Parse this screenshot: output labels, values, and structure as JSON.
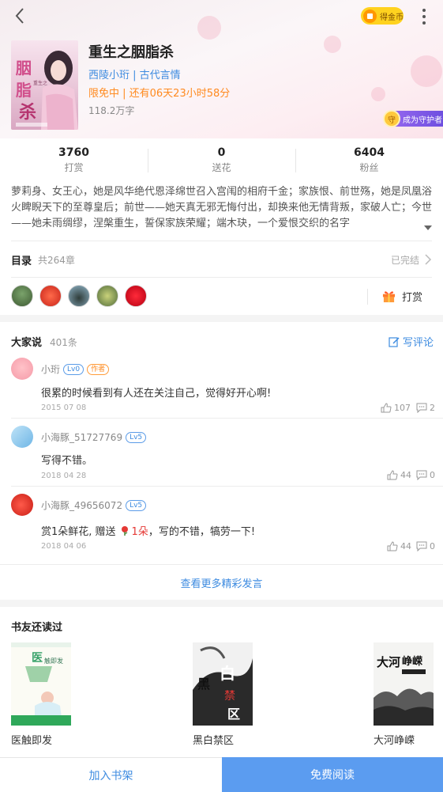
{
  "colors": {
    "accent": "#3d8be0",
    "primary_button": "#5b9cf0",
    "free_orange": "#ff8a1f",
    "coin_yellow": "#ffd21f",
    "guard_purple": "#8a5cf0"
  },
  "header": {
    "back_icon": "chevron-left-icon",
    "coin_label": "得金币",
    "more_icon": "vertical-dots-icon"
  },
  "book": {
    "title": "重生之胭脂杀",
    "author_category": "西陵小珩 | 古代言情",
    "free_status": "限免中 | 还有06天23小时58分",
    "word_count": "118.2万字",
    "cover_text": "胭脂杀",
    "cover_subtext": "重生之"
  },
  "guard_badge": {
    "label": "成为守护者",
    "icon_text": "守"
  },
  "stats": [
    {
      "value": "3760",
      "label": "打赏"
    },
    {
      "value": "0",
      "label": "送花"
    },
    {
      "value": "6404",
      "label": "粉丝"
    }
  ],
  "intro": "萝莉身、女王心，她是风华绝代恩泽绵世召入宫闱的相府千金；家族恨、前世殇，她是凤凰浴火睥睨天下的至尊皇后；前世——她天真无邪无悔付出，却换来他无情背叛，家破人亡；今世——她未雨绸缪，涅槃重生，誓保家族荣耀；端木玦，一个爱恨交织的名字",
  "toc": {
    "label": "目录",
    "count": "共264章",
    "status": "已完结"
  },
  "tip_button": {
    "label": "打赏",
    "icon": "gift-icon"
  },
  "comments_section": {
    "title": "大家说",
    "count": "401条",
    "write_label": "写评论"
  },
  "comments": [
    {
      "user": "小珩",
      "level": "Lv0",
      "tag": "作者",
      "text": "很累的时候看到有人还在关注自己，觉得好开心啊!",
      "date": "2015 07 08",
      "likes": "107",
      "replies": "2"
    },
    {
      "user": "小海豚_51727769",
      "level": "Lv5",
      "text": "写得不错。",
      "date": "2018 04 28",
      "likes": "44",
      "replies": "0"
    },
    {
      "user": "小海豚_49656072",
      "level": "Lv5",
      "text_a": "赏1朵鲜花, 赠送",
      "text_b": "1朵",
      "text_c": "，写的不错，犒劳一下!",
      "date": "2018 04 06",
      "likes": "44",
      "replies": "0"
    }
  ],
  "more_comments": "查看更多精彩发言",
  "also_read": {
    "title": "书友还读过",
    "books": [
      {
        "name": "医触即发",
        "cover_text": "医触即发"
      },
      {
        "name": "黑白禁区",
        "cover_text": "黑白禁区"
      },
      {
        "name": "大河峥嵘",
        "cover_text": "大河峥嵘"
      }
    ]
  },
  "bottom": {
    "shelf_label": "加入书架",
    "read_label": "免费阅读"
  }
}
